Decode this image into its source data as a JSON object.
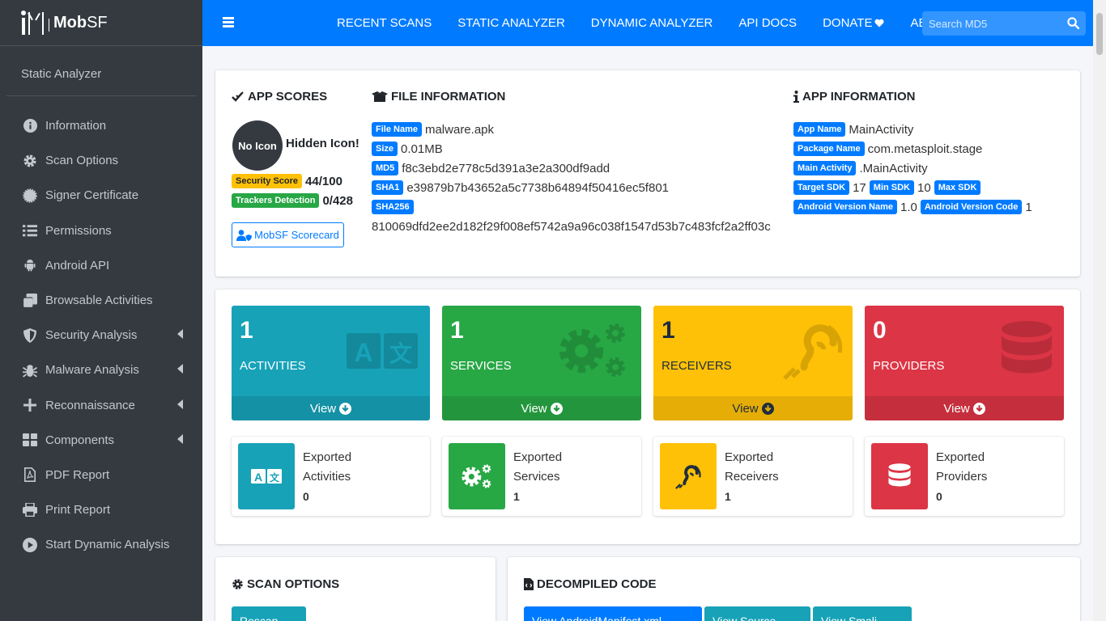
{
  "brand": {
    "name_bold": "Mob",
    "name_rest": "SF"
  },
  "sidebar": {
    "section_title": "Static Analyzer",
    "items": [
      {
        "label": "Information",
        "icon": "info-circle-icon"
      },
      {
        "label": "Scan Options",
        "icon": "gear-icon"
      },
      {
        "label": "Signer Certificate",
        "icon": "certificate-icon"
      },
      {
        "label": "Permissions",
        "icon": "list-icon"
      },
      {
        "label": "Android API",
        "icon": "android-icon"
      },
      {
        "label": "Browsable Activities",
        "icon": "clone-icon"
      },
      {
        "label": "Security Analysis",
        "icon": "shield-icon"
      },
      {
        "label": "Malware Analysis",
        "icon": "bug-icon"
      },
      {
        "label": "Reconnaissance",
        "icon": "plus-icon"
      },
      {
        "label": "Components",
        "icon": "th-large-icon"
      },
      {
        "label": "PDF Report",
        "icon": "file-pdf-icon"
      },
      {
        "label": "Print Report",
        "icon": "print-icon"
      },
      {
        "label": "Start Dynamic Analysis",
        "icon": "play-circle-icon"
      }
    ]
  },
  "topnav": {
    "items": [
      "RECENT SCANS",
      "STATIC ANALYZER",
      "DYNAMIC ANALYZER",
      "API DOCS",
      "DONATE",
      "ABOUT"
    ],
    "search_placeholder": "Search MD5"
  },
  "app_scores": {
    "title": "APP SCORES",
    "icon_text": "No Icon",
    "hidden_icon": "Hidden Icon!",
    "security_score_label": "Security Score",
    "security_score": "44/100",
    "trackers_label": "Trackers Detection",
    "trackers": "0/428",
    "scorecard_button": "MobSF Scorecard"
  },
  "file_info": {
    "title": "FILE INFORMATION",
    "file_name_label": "File Name",
    "file_name": "malware.apk",
    "size_label": "Size",
    "size": "0.01MB",
    "md5_label": "MD5",
    "md5": "f8c3ebd2e778c5d391a3e2a300df9add",
    "sha1_label": "SHA1",
    "sha1": "e39879b7b43652a5c7738b64894f50416ec5f801",
    "sha256_label": "SHA256",
    "sha256": "810069dfd2ee2d182f29f008ef5742a9a96c038f1547d53b7c483fcf2a2ff03c"
  },
  "app_info": {
    "title": "APP INFORMATION",
    "app_name_label": "App Name",
    "app_name": "MainActivity",
    "package_label": "Package Name",
    "package": "com.metasploit.stage",
    "main_activity_label": "Main Activity",
    "main_activity": ".MainActivity",
    "target_sdk_label": "Target SDK",
    "target_sdk": "17",
    "min_sdk_label": "Min SDK",
    "min_sdk": "10",
    "max_sdk_label": "Max SDK",
    "max_sdk": "",
    "version_name_label": "Android Version Name",
    "version_name": "1.0",
    "version_code_label": "Android Version Code",
    "version_code": "1"
  },
  "components": [
    {
      "count": "1",
      "label": "ACTIVITIES",
      "view": "View",
      "color": "#17a2b8"
    },
    {
      "count": "1",
      "label": "SERVICES",
      "view": "View",
      "color": "#28a745"
    },
    {
      "count": "1",
      "label": "RECEIVERS",
      "view": "View",
      "color": "#ffc107"
    },
    {
      "count": "0",
      "label": "PROVIDERS",
      "view": "View",
      "color": "#dc3545"
    }
  ],
  "exported": [
    {
      "line1": "Exported",
      "line2": "Activities",
      "count": "0"
    },
    {
      "line1": "Exported",
      "line2": "Services",
      "count": "1"
    },
    {
      "line1": "Exported",
      "line2": "Receivers",
      "count": "1"
    },
    {
      "line1": "Exported",
      "line2": "Providers",
      "count": "0"
    }
  ],
  "scan_options": {
    "title": "SCAN OPTIONS",
    "rescan": "Rescan"
  },
  "decompiled": {
    "title": "DECOMPILED CODE",
    "manifest": "View AndroidManifest.xml",
    "source": "View Source",
    "smali": "View Smali"
  }
}
